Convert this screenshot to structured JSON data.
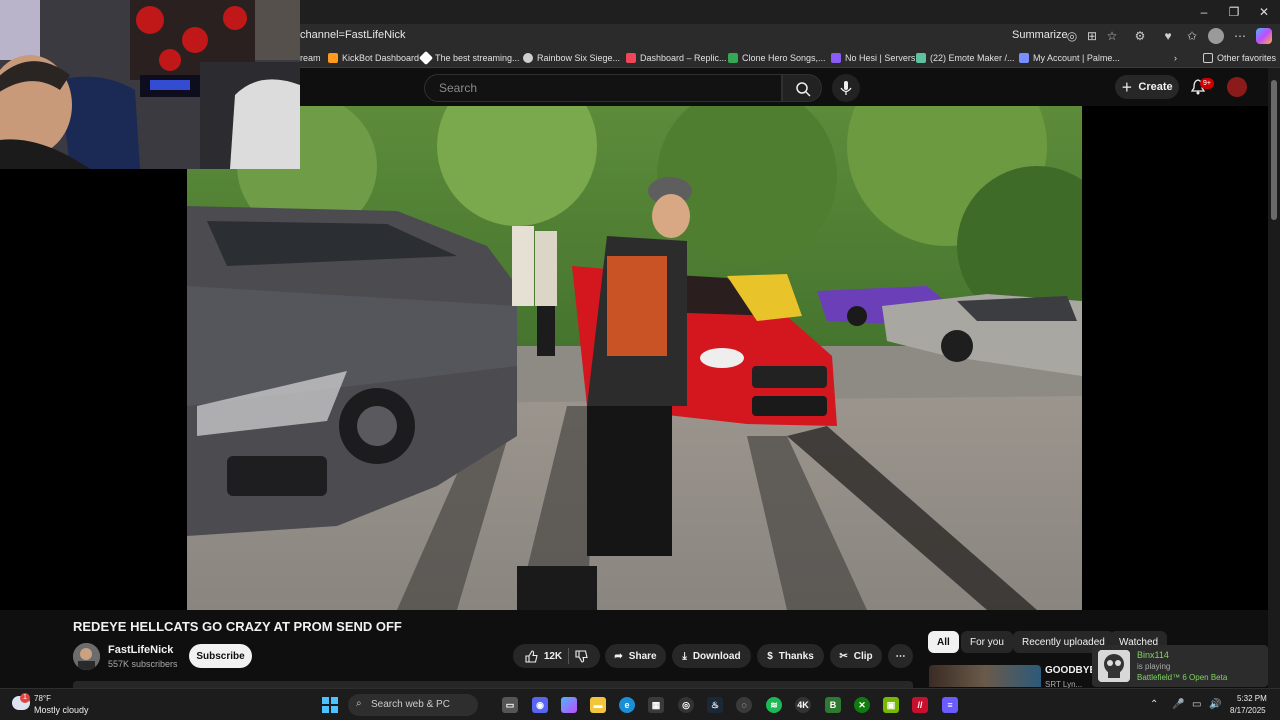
{
  "browser": {
    "url": "channel=FastLifeNick",
    "summarize_label": "Summarize",
    "bookmarks": [
      {
        "label": "ream",
        "color": "#2b2b2b"
      },
      {
        "label": "KickBot Dashboard",
        "color": "#ff9a1f"
      },
      {
        "label": "The best streaming...",
        "color": "#ffffff"
      },
      {
        "label": "Rainbow Six Siege...",
        "color": "#cfcfcf"
      },
      {
        "label": "Dashboard – Replic...",
        "color": "#f1465a"
      },
      {
        "label": "Clone Hero Songs,...",
        "color": "#34a853"
      },
      {
        "label": "No Hesi | Servers",
        "color": "#8a5cf6"
      },
      {
        "label": "(22) Emote Maker /...",
        "color": "#5cc2a0"
      },
      {
        "label": "My Account | Palme...",
        "color": "#7a8fff"
      }
    ],
    "other_favorites": "Other favorites"
  },
  "youtube": {
    "search_placeholder": "Search",
    "create_label": "Create",
    "notification_count": "9+"
  },
  "video": {
    "title": "REDEYE HELLCATS GO CRAZY AT PROM SEND OFF",
    "channel_name": "FastLifeNick",
    "subscribers": "557K subscribers",
    "subscribe_label": "Subscribe",
    "likes": "12K",
    "share_label": "Share",
    "download_label": "Download",
    "thanks_label": "Thanks",
    "clip_label": "Clip"
  },
  "filter_chips": [
    "All",
    "For you",
    "Recently uploaded",
    "Watched"
  ],
  "recommendation": {
    "title": "GOODBYE",
    "meta": "SRT Lyn..."
  },
  "toast": {
    "name": "Binx114",
    "status": "is playing",
    "game": "Battlefield™ 6 Open Beta"
  },
  "taskbar": {
    "temperature": "78°F",
    "weather": "Mostly cloudy",
    "weather_badge": "1",
    "search_label": "Search web & PC",
    "time": "5:32 PM",
    "date": "8/17/2025"
  }
}
